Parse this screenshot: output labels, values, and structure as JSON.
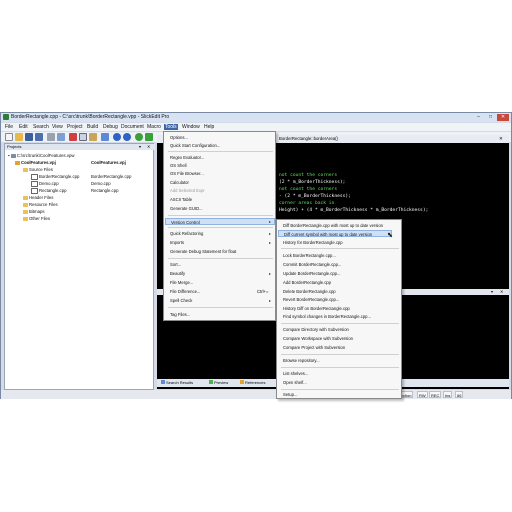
{
  "window": {
    "title": "BorderRectangle.cpp - C:\\src\\trunk\\BorderRectangle.vpp - SlickEdit Pro",
    "min": "–",
    "max": "□",
    "close": "✕"
  },
  "menubar": [
    "File",
    "Edit",
    "Search",
    "View",
    "Project",
    "Build",
    "Debug",
    "Document",
    "Macro",
    "Tools",
    "Window",
    "Help"
  ],
  "editor": {
    "context": "BorderRectangle::borderArea()",
    "lines": [
      {
        "text": "not count the corners",
        "comment": true
      },
      {
        "text": " (2 * m_BorderThickness);",
        "comment": false
      },
      {
        "text": "not count the corners",
        "comment": true
      },
      {
        "text": " - (2 * m_BorderThickness);",
        "comment": false
      },
      {
        "text": " corner areas back in",
        "comment": true
      },
      {
        "text": "Height) + (4 * m_BorderThickness * m_BorderThickness);",
        "comment": false
      }
    ]
  },
  "projects": {
    "header": "Projects",
    "tree": [
      {
        "label": "C:\\src\\trunk\\CoolFeatures.vpw",
        "bold": false,
        "icon": "workspace"
      },
      {
        "label": "CoolFeatures.vpj",
        "bold": true,
        "icon": "project"
      },
      {
        "label": "Source Files",
        "bold": false,
        "icon": "folder"
      },
      {
        "label": "BorderRectangle.cpp",
        "bold": false,
        "icon": "file"
      },
      {
        "label": "Demo.cpp",
        "bold": false,
        "icon": "file"
      },
      {
        "label": "Rectangle.cpp",
        "bold": false,
        "icon": "file"
      },
      {
        "label": "Header Files",
        "bold": false,
        "icon": "folder"
      },
      {
        "label": "Resource Files",
        "bold": false,
        "icon": "folder"
      },
      {
        "label": "Bitmaps",
        "bold": false,
        "icon": "folder"
      },
      {
        "label": "Other Files",
        "bold": false,
        "icon": "folder"
      }
    ],
    "side": [
      "CoolFeatures.vpj",
      "BorderRectangle.cpp",
      "Demo.cpp",
      "Rectangle.cpp"
    ],
    "tabs": [
      "Projects",
      "Defs",
      "Class",
      "Symbols",
      "Open"
    ]
  },
  "bottom_tabs": [
    "Search Results",
    "Preview",
    "References"
  ],
  "status": [
    "Selection",
    "RW",
    "REC",
    "Ins",
    "66"
  ],
  "tools_menu": {
    "items": [
      {
        "label": "Options...",
        "shortcut": "",
        "sub": false,
        "dis": false
      },
      {
        "label": "Quick Start Configuration...",
        "shortcut": "",
        "sub": false,
        "dis": false
      },
      {
        "label": "Regex Evaluator...",
        "shortcut": "",
        "sub": false,
        "dis": false
      },
      {
        "label": "OS Shell",
        "shortcut": "",
        "sub": false,
        "dis": false
      },
      {
        "label": "OS File Browser...",
        "shortcut": "",
        "sub": false,
        "dis": false
      },
      {
        "label": "Calculator",
        "shortcut": "",
        "sub": false,
        "dis": false
      },
      {
        "label": "Add Selected Expr",
        "shortcut": "",
        "sub": false,
        "dis": true
      },
      {
        "label": "ASCII Table",
        "shortcut": "",
        "sub": false,
        "dis": false
      },
      {
        "label": "Generate GUID...",
        "shortcut": "",
        "sub": false,
        "dis": false
      },
      {
        "label": "Version Control",
        "shortcut": "",
        "sub": true,
        "dis": false,
        "hl": true
      },
      {
        "label": "Quick Refactoring",
        "shortcut": "",
        "sub": true,
        "dis": false
      },
      {
        "label": "Imports",
        "shortcut": "",
        "sub": true,
        "dis": false
      },
      {
        "label": "Generate Debug Statement for float",
        "shortcut": "",
        "sub": false,
        "dis": false
      },
      {
        "label": "Sort...",
        "shortcut": "",
        "sub": false,
        "dis": false
      },
      {
        "label": "Beautify",
        "shortcut": "",
        "sub": true,
        "dis": false
      },
      {
        "label": "File Merge...",
        "shortcut": "",
        "sub": false,
        "dis": false
      },
      {
        "label": "File Difference...",
        "shortcut": "Ctrl+=",
        "sub": false,
        "dis": false
      },
      {
        "label": "Spell Check",
        "shortcut": "",
        "sub": true,
        "dis": false
      },
      {
        "label": "Tag Files...",
        "shortcut": "",
        "sub": false,
        "dis": false
      }
    ]
  },
  "vc_menu": {
    "items": [
      {
        "label": "Diff BorderRectangle.cpp with most up to date version"
      },
      {
        "label": "Diff current symbol with most up to date version",
        "hl": true
      },
      {
        "label": "History for BorderRectangle.cpp"
      },
      {
        "label": "Lock BorderRectangle.cpp..."
      },
      {
        "label": "Commit BorderRectangle.cpp..."
      },
      {
        "label": "Update BorderRectangle.cpp..."
      },
      {
        "label": "Add BorderRectangle.cpp"
      },
      {
        "label": "Delete BorderRectangle.cpp"
      },
      {
        "label": "Revert BorderRectangle.cpp..."
      },
      {
        "label": "History Diff on BorderRectangle.cpp"
      },
      {
        "label": "Find symbol changes in BorderRectangle.cpp..."
      },
      {
        "label": "Compare Directory with Subversion"
      },
      {
        "label": "Compare Workspace with Subversion"
      },
      {
        "label": "Compare Project with Subversion"
      },
      {
        "label": "Browse repository..."
      },
      {
        "label": "List shelves..."
      },
      {
        "label": "Open shelf..."
      },
      {
        "label": "Setup..."
      }
    ]
  },
  "colors": {
    "accent": "#3d66a8",
    "editor_bg": "#000000",
    "comment": "#5fe05f",
    "highlight": "#cfe0f5"
  }
}
